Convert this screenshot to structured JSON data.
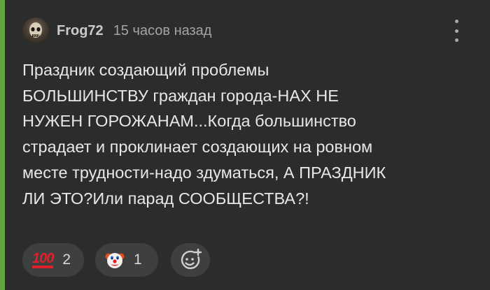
{
  "comment": {
    "author": "Frog72",
    "time": "15 часов назад",
    "text": "Праздник создающий проблемы\nБОЛЬШИНСТВУ граждан города-НАХ НЕ\nНУЖЕН ГОРОЖАНАМ...Когда большинство\nстрадает и проклинает создающих на ровном\nместе трудности-надо здуматься, А ПРАЗДНИК\nЛИ ЭТО?Или парад СООБЩЕСТВА?!"
  },
  "reactions": [
    {
      "icon": "hundred-points-icon",
      "emoji": "100",
      "count": "2"
    },
    {
      "icon": "clown-face-icon",
      "count": "1"
    }
  ],
  "add_reaction": {
    "icon": "add-reaction-icon"
  },
  "colors": {
    "background": "#2b2c2c",
    "accent": "#65a53f",
    "pill": "#3e3f3f",
    "text": "#e6e7e7",
    "muted": "#a3a5a5"
  }
}
